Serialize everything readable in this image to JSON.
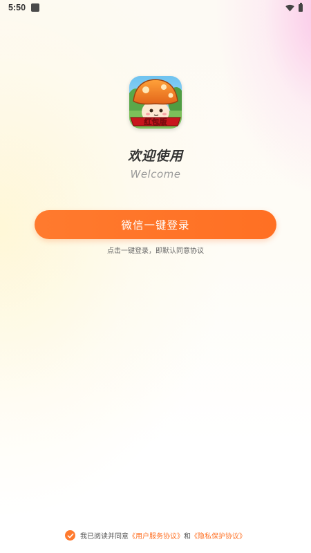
{
  "status_bar": {
    "time": "5:50",
    "icons": [
      "notification-icon",
      "wifi-icon",
      "battery-icon"
    ]
  },
  "logo": {
    "icon": "mushroom-game-logo",
    "banner_text": "红包版"
  },
  "welcome": {
    "title": "欢迎使用",
    "subtitle": "Welcome"
  },
  "login": {
    "button_label": "微信一键登录",
    "hint": "点击一键登录，即默认同意协议"
  },
  "agreement": {
    "checked": true,
    "prefix": "我已阅读并同意",
    "user_agreement_link": "《用户服务协议》",
    "joiner": "和",
    "privacy_link": "《隐私保护协议》"
  },
  "colors": {
    "accent": "#ff7023",
    "title": "#333333",
    "subtitle": "#9a9a9a"
  }
}
